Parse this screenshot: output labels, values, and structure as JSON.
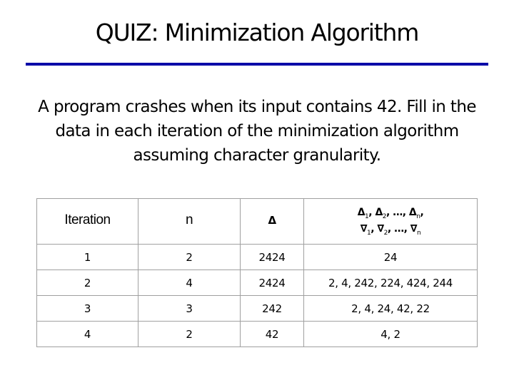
{
  "slide": {
    "title": "QUIZ: Minimization Algorithm",
    "accent_color": "#0a0aa8",
    "question": "A program crashes when its input contains 42. Fill in the data in each iteration of the minimization algorithm assuming character granularity."
  },
  "table": {
    "headers": {
      "iteration": "Iteration",
      "n": "n",
      "delta": "Δ",
      "subsets_line1": [
        "Δ",
        "1",
        ", Δ",
        "2",
        ", …, Δ",
        "n",
        ","
      ],
      "subsets_line2": [
        "∇",
        "1",
        ", ∇",
        "2",
        ", …, ∇",
        "n"
      ]
    },
    "rows": [
      {
        "iteration": "1",
        "n": "2",
        "delta": "2424",
        "subsets": "24"
      },
      {
        "iteration": "2",
        "n": "4",
        "delta": "2424",
        "subsets": "2, 4, 242, 224, 424, 244"
      },
      {
        "iteration": "3",
        "n": "3",
        "delta": "242",
        "subsets": "2, 4, 24, 42, 22"
      },
      {
        "iteration": "4",
        "n": "2",
        "delta": "42",
        "subsets": "4, 2"
      }
    ]
  }
}
